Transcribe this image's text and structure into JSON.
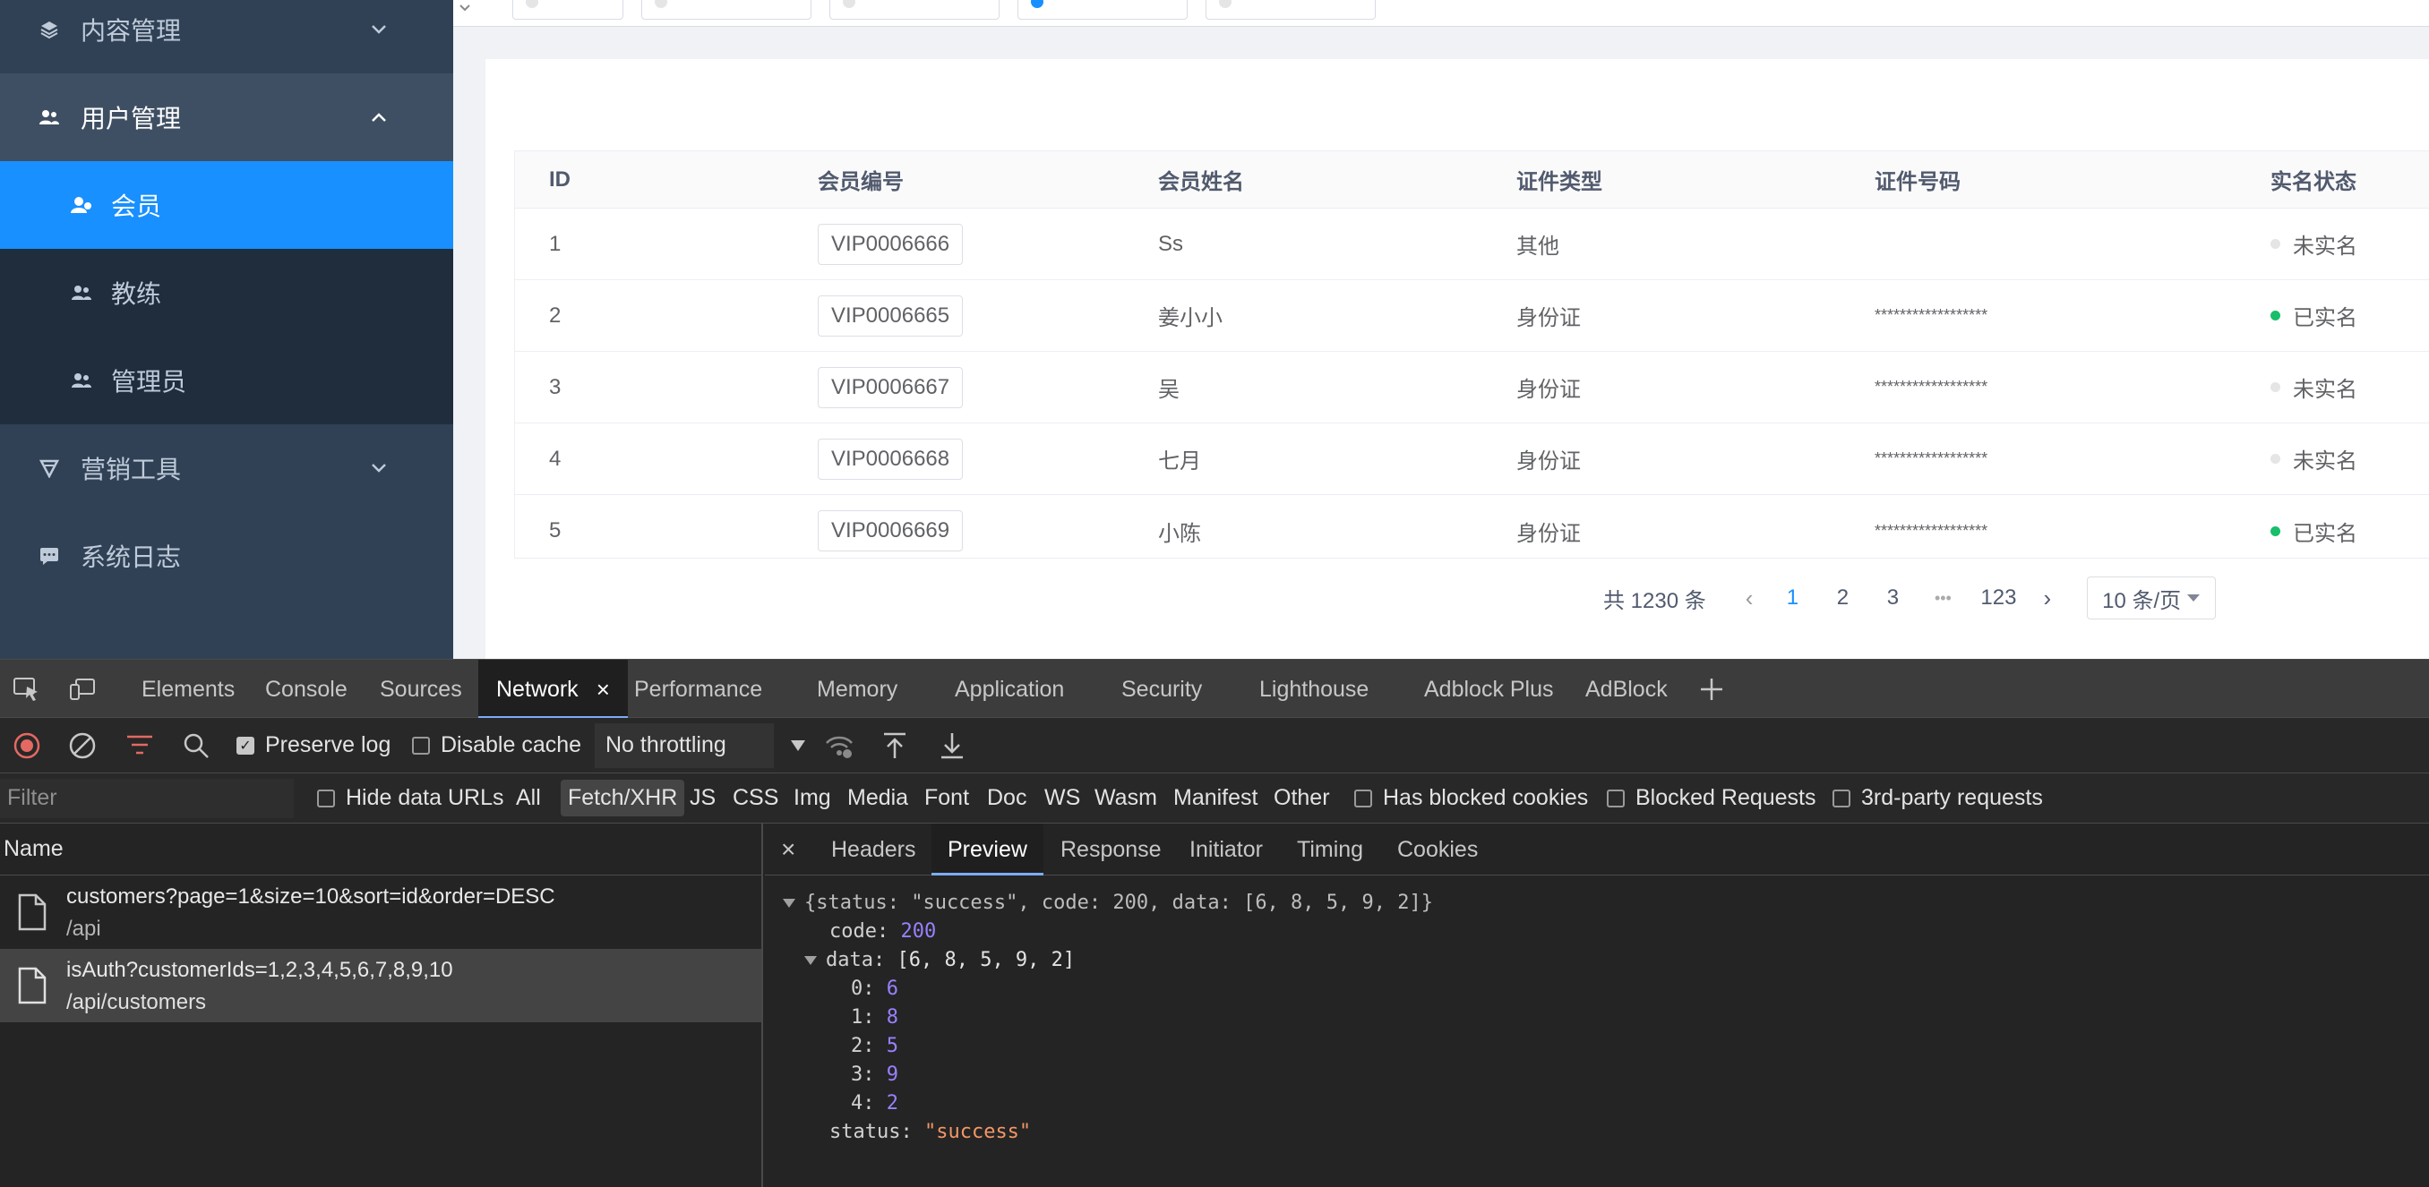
{
  "sidebar": {
    "items": [
      {
        "label": "内容管理",
        "icon": "layers-icon"
      },
      {
        "label": "用户管理",
        "icon": "users-icon"
      },
      {
        "label": "会员",
        "icon": "member-icon"
      },
      {
        "label": "教练",
        "icon": "coach-icon"
      },
      {
        "label": "管理员",
        "icon": "admin-icon"
      },
      {
        "label": "营销工具",
        "icon": "marketing-icon"
      },
      {
        "label": "系统日志",
        "icon": "log-icon"
      }
    ]
  },
  "table": {
    "headers": [
      "ID",
      "会员编号",
      "会员姓名",
      "证件类型",
      "证件号码",
      "实名状态"
    ],
    "rows": [
      {
        "id": "1",
        "vip": "VIP0006666",
        "name": "Ss",
        "idtype": "其他",
        "idno": "",
        "status": "未实名"
      },
      {
        "id": "2",
        "vip": "VIP0006665",
        "name": "姜小小",
        "idtype": "身份证",
        "idno": "******************",
        "status": "已实名"
      },
      {
        "id": "3",
        "vip": "VIP0006667",
        "name": "吴",
        "idtype": "身份证",
        "idno": "******************",
        "status": "未实名"
      },
      {
        "id": "4",
        "vip": "VIP0006668",
        "name": "七月",
        "idtype": "身份证",
        "idno": "******************",
        "status": "未实名"
      },
      {
        "id": "5",
        "vip": "VIP0006669",
        "name": "小陈",
        "idtype": "身份证",
        "idno": "******************",
        "status": "已实名"
      }
    ]
  },
  "pager": {
    "total": "共 1230 条",
    "pages": [
      "1",
      "2",
      "3",
      "•••",
      "123"
    ],
    "size": "10 条/页"
  },
  "devtools": {
    "tabs": [
      "Elements",
      "Console",
      "Sources",
      "Network",
      "Performance",
      "Memory",
      "Application",
      "Security",
      "Lighthouse",
      "Adblock Plus",
      "AdBlock"
    ],
    "preserve_log": "Preserve log",
    "disable_cache": "Disable cache",
    "throttling": "No throttling",
    "filter_placeholder": "Filter",
    "hide_data_urls": "Hide data URLs",
    "types": [
      "All",
      "Fetch/XHR",
      "JS",
      "CSS",
      "Img",
      "Media",
      "Font",
      "Doc",
      "WS",
      "Wasm",
      "Manifest",
      "Other"
    ],
    "has_blocked_cookies": "Has blocked cookies",
    "blocked_requests": "Blocked Requests",
    "third_party": "3rd-party requests",
    "name_header": "Name",
    "requests": [
      {
        "name": "customers?page=1&size=10&sort=id&order=DESC",
        "path": "/api"
      },
      {
        "name": "isAuth?customerIds=1,2,3,4,5,6,7,8,9,10",
        "path": "/api/customers"
      }
    ],
    "panel_tabs": [
      "Headers",
      "Preview",
      "Response",
      "Initiator",
      "Timing",
      "Cookies"
    ],
    "preview": {
      "summary": "{status: \"success\", code: 200, data: [6, 8, 5, 9, 2]}",
      "code_key": "code:",
      "code_val": "200",
      "data_key": "data:",
      "data_summary": "[6, 8, 5, 9, 2]",
      "items": [
        {
          "k": "0:",
          "v": "6"
        },
        {
          "k": "1:",
          "v": "8"
        },
        {
          "k": "2:",
          "v": "5"
        },
        {
          "k": "3:",
          "v": "9"
        },
        {
          "k": "4:",
          "v": "2"
        }
      ],
      "status_key": "status:",
      "status_val": "\"success\""
    }
  }
}
